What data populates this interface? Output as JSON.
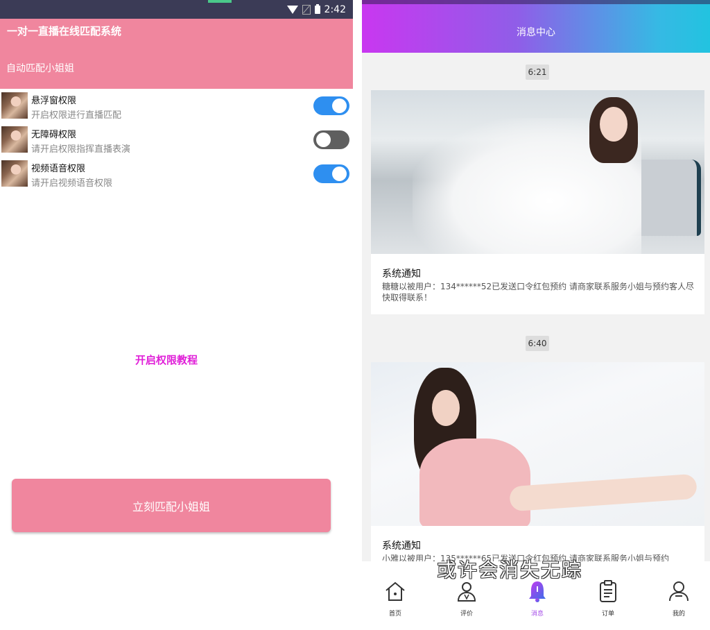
{
  "left": {
    "status_time": "2:42",
    "app_title": "一对一直播在线匹配系统",
    "subtitle": "自动匹配小姐姐",
    "permissions": [
      {
        "title": "悬浮窗权限",
        "desc": "开启权限进行直播匹配",
        "enabled": true
      },
      {
        "title": "无障碍权限",
        "desc": "请开启权限指挥直播表演",
        "enabled": false
      },
      {
        "title": "视频语音权限",
        "desc": "请开启视频语音权限",
        "enabled": true
      }
    ],
    "tutorial_link": "开启权限教程",
    "match_button": "立刻匹配小姐姐"
  },
  "right": {
    "header_title": "消息中心",
    "messages": [
      {
        "time": "6:21",
        "title": "系统通知",
        "body": "糖糖以被用户：134******52已发送口令红包预约 请商家联系服务小姐与预约客人尽快取得联系！"
      },
      {
        "time": "6:40",
        "title": "系统通知",
        "body": "小雅以被用户：135******65已发送口令红包预约 请商家联系服务小姐与预约"
      }
    ],
    "tabs": [
      {
        "label": "首页",
        "icon": "home-icon",
        "active": false
      },
      {
        "label": "评价",
        "icon": "review-icon",
        "active": false
      },
      {
        "label": "消息",
        "icon": "bell-icon",
        "active": true
      },
      {
        "label": "订单",
        "icon": "clipboard-icon",
        "active": false
      },
      {
        "label": "我的",
        "icon": "user-icon",
        "active": false
      }
    ],
    "watermark": "或许会消失无踪"
  },
  "colors": {
    "pink": "#f0869e",
    "toggle_on": "#2e8ff0",
    "toggle_off": "#5f5f5f",
    "link": "#e020d8",
    "tab_active": "#a44be8"
  }
}
